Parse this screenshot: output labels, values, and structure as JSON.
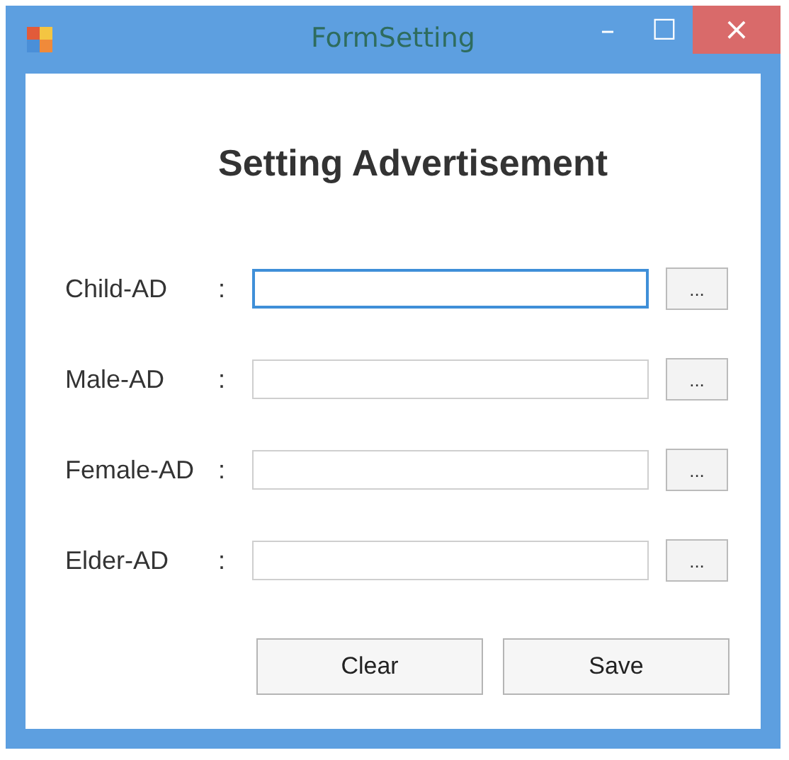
{
  "window": {
    "title": "FormSetting",
    "controls": [
      "–",
      "☐",
      "×"
    ]
  },
  "heading": "Setting Advertisement",
  "fields": [
    {
      "label": "Child-AD",
      "colon": ":",
      "focused": true,
      "browse": "..."
    },
    {
      "label": "Male-AD",
      "colon": ":",
      "focused": false,
      "browse": "..."
    },
    {
      "label": "Female-AD",
      "colon": ":",
      "focused": false,
      "browse": "..."
    },
    {
      "label": "Elder-AD",
      "colon": ":",
      "focused": false,
      "browse": "..."
    }
  ],
  "buttons": [
    "Clear",
    "Save"
  ]
}
